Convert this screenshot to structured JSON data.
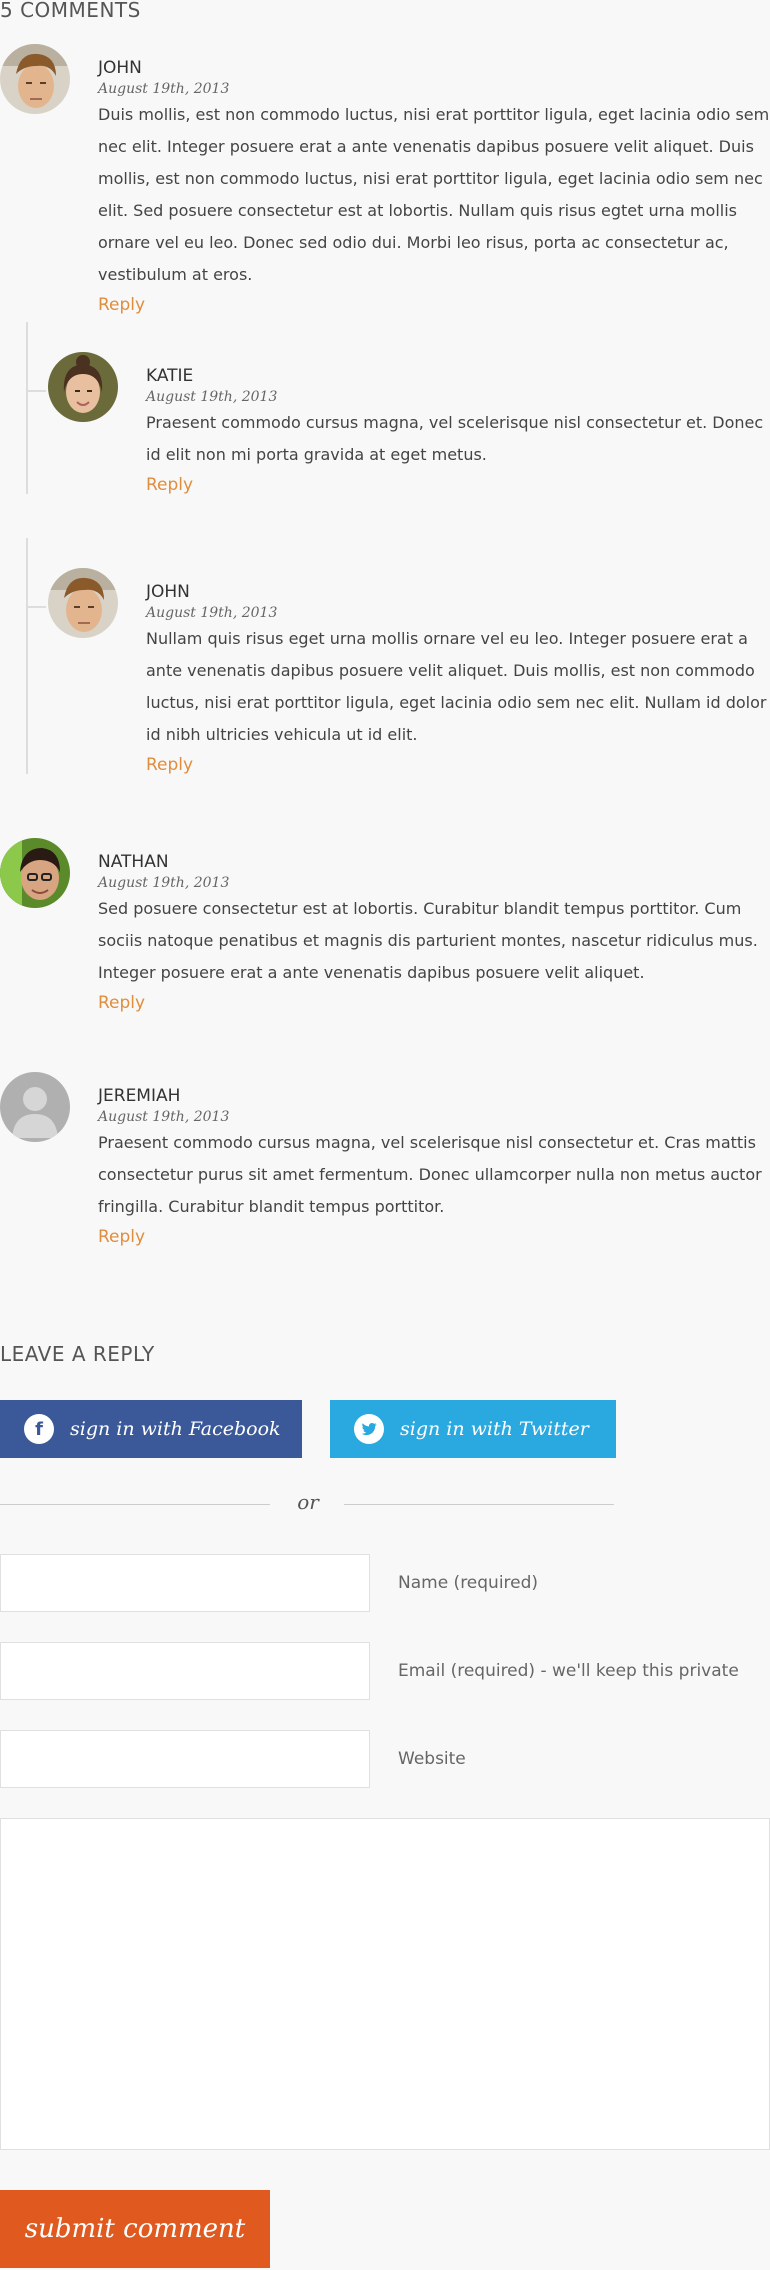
{
  "comments_title": "5 COMMENTS",
  "reply_label": "Reply",
  "comments": [
    {
      "author": "JOHN",
      "date": "August 19th, 2013",
      "text": "Duis mollis, est non commodo luctus, nisi erat porttitor ligula, eget lacinia odio sem nec elit. Integer posuere erat a ante venenatis dapibus posuere velit aliquet. Duis mollis, est non commodo luctus, nisi erat porttitor ligula, eget lacinia odio sem nec elit. Sed posuere consectetur est at lobortis. Nullam quis risus egtet urna mollis ornare vel eu leo. Donec sed odio dui. Morbi leo risus, porta ac consectetur ac, vestibulum at eros."
    },
    {
      "author": "KATIE",
      "date": "August 19th, 2013",
      "text": "Praesent commodo cursus magna, vel scelerisque nisl consectetur et. Donec id elit non mi porta gravida at eget metus."
    },
    {
      "author": "JOHN",
      "date": "August 19th, 2013",
      "text": "Nullam quis risus eget urna mollis ornare vel eu leo. Integer posuere erat a ante venenatis dapibus posuere velit aliquet. Duis mollis, est non commodo luctus, nisi erat porttitor ligula, eget lacinia odio sem nec elit. Nullam id dolor id nibh ultricies vehicula ut id elit."
    },
    {
      "author": "NATHAN",
      "date": "August 19th, 2013",
      "text": "Sed posuere consectetur est at lobortis. Curabitur blandit tempus porttitor. Cum sociis natoque penatibus et magnis dis parturient montes, nascetur ridiculus mus. Integer posuere erat a ante venenatis dapibus posuere velit aliquet."
    },
    {
      "author": "JEREMIAH",
      "date": "August 19th, 2013",
      "text": "Praesent commodo cursus magna, vel scelerisque nisl consectetur et. Cras mattis consectetur purus sit amet fermentum. Donec ullamcorper nulla non metus auctor fringilla. Curabitur blandit tempus porttitor."
    }
  ],
  "reply_form": {
    "title": "LEAVE A REPLY",
    "facebook_label": "sign in with Facebook",
    "twitter_label": "sign in with Twitter",
    "or_label": "or",
    "name_label": "Name (required)",
    "email_label": "Email (required) - we'll keep this private",
    "website_label": "Website",
    "submit_label": "submit comment"
  },
  "colors": {
    "accent": "#e08d3c",
    "facebook": "#3b5998",
    "twitter": "#2aa8e0",
    "submit": "#e05a1f"
  }
}
